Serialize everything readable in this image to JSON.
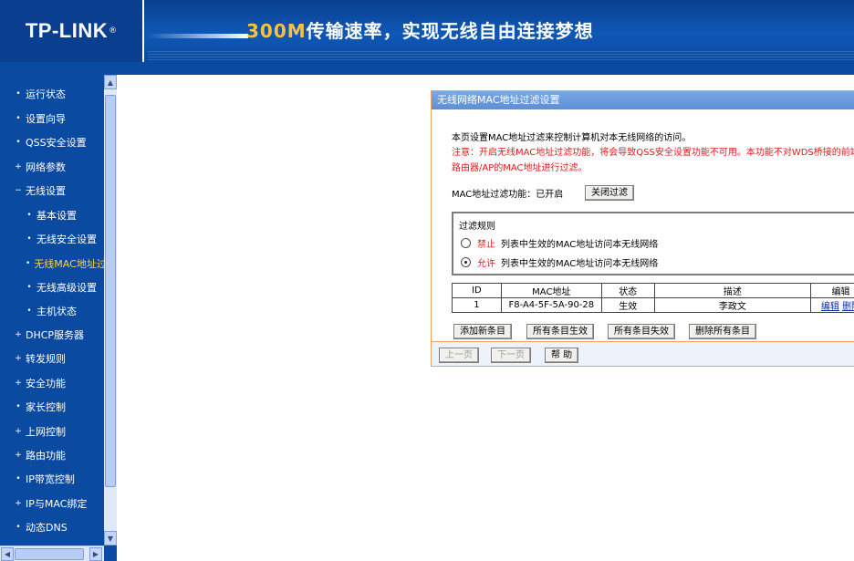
{
  "header": {
    "logo": "TP-LINK",
    "logo_mark": "®",
    "slogan_accent": "300M",
    "slogan_text": "传输速率，实现无线自由连接梦想"
  },
  "sidebar": {
    "items": [
      {
        "label": "运行状态",
        "bullet": "•"
      },
      {
        "label": "设置向导",
        "bullet": "•"
      },
      {
        "label": "QSS安全设置",
        "bullet": "•"
      },
      {
        "label": "网络参数",
        "bullet": "+"
      },
      {
        "label": "无线设置",
        "bullet": "−"
      },
      {
        "label": "基本设置",
        "bullet": "•"
      },
      {
        "label": "无线安全设置",
        "bullet": "•"
      },
      {
        "label": "无线MAC地址过滤",
        "bullet": "•"
      },
      {
        "label": "无线高级设置",
        "bullet": "•"
      },
      {
        "label": "主机状态",
        "bullet": "•"
      },
      {
        "label": "DHCP服务器",
        "bullet": "+"
      },
      {
        "label": "转发规则",
        "bullet": "+"
      },
      {
        "label": "安全功能",
        "bullet": "+"
      },
      {
        "label": "家长控制",
        "bullet": "•"
      },
      {
        "label": "上网控制",
        "bullet": "+"
      },
      {
        "label": "路由功能",
        "bullet": "+"
      },
      {
        "label": "IP带宽控制",
        "bullet": "•"
      },
      {
        "label": "IP与MAC绑定",
        "bullet": "+"
      },
      {
        "label": "动态DNS",
        "bullet": "•"
      }
    ],
    "active_index": 7
  },
  "panel": {
    "title": "无线网络MAC地址过滤设置",
    "description": "本页设置MAC地址过滤来控制计算机对本无线网络的访问。",
    "warning_line1": "注意：开启无线MAC地址过滤功能，将会导致QSS安全设置功能不可用。本功能不对WDS桥接的前端",
    "warning_line2": "路由器/AP的MAC地址进行过滤。",
    "filter_status_label": "MAC地址过滤功能：",
    "filter_status_value": "已开启",
    "toggle_button": "关闭过滤",
    "rules_title": "过滤规则",
    "rule_deny_key": "禁止",
    "rule_deny_text": "列表中生效的MAC地址访问本无线网络",
    "rule_allow_key": "允许",
    "rule_allow_text": "列表中生效的MAC地址访问本无线网络",
    "selected_rule": "允许"
  },
  "table": {
    "headers": [
      "ID",
      "MAC地址",
      "状态",
      "描述",
      "编辑"
    ],
    "rows": [
      {
        "id": "1",
        "mac": "F8-A4-5F-5A-90-28",
        "status": "生效",
        "desc": "李政文",
        "edit": "编辑",
        "delete": "删除"
      }
    ]
  },
  "actions": {
    "add": "添加新条目",
    "enable_all": "所有条目生效",
    "disable_all": "所有条目失效",
    "delete_all": "删除所有条目"
  },
  "footer": {
    "prev": "上一页",
    "next": "下一页",
    "help": "帮 助"
  },
  "colors": {
    "brand_blue": "#0a4aa0",
    "panel_border": "#f2a35e",
    "warning_red": "#e0191b",
    "active_menu": "#ffd23c"
  },
  "icons": {
    "scroll_up": "▲",
    "scroll_down": "▼",
    "scroll_left": "◀",
    "scroll_right": "▶"
  }
}
